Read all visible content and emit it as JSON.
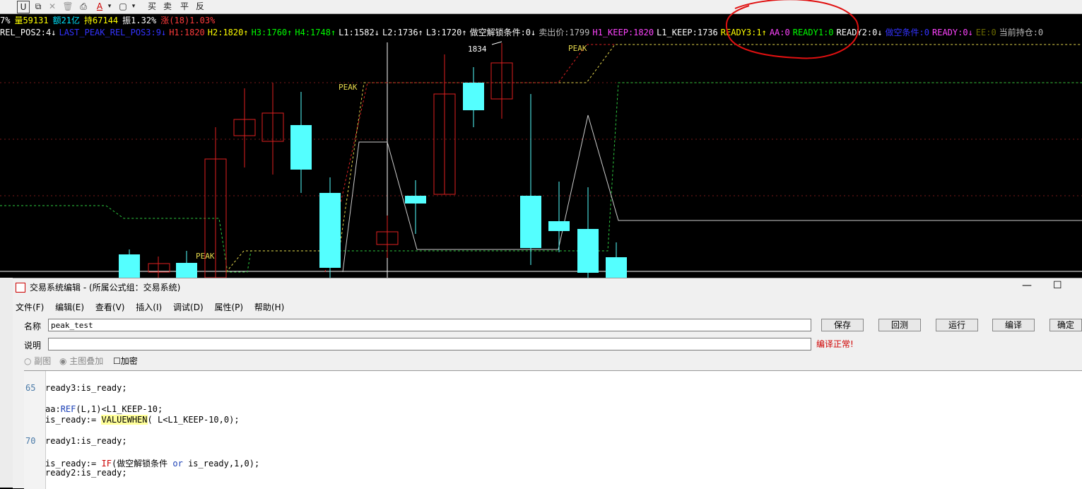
{
  "toolbar": {
    "buttons": [
      "U",
      "⧉",
      "✕",
      "🗑",
      "⎙",
      "A",
      "▾",
      "▢",
      "▾",
      "买",
      "卖",
      "平",
      "反"
    ]
  },
  "status_bar": [
    {
      "text": "7%",
      "color": "#ffffff"
    },
    {
      "text": "量59131",
      "color": "#ffff00"
    },
    {
      "text": "额21亿",
      "color": "#00e5ff"
    },
    {
      "text": "持67144",
      "color": "#ffff00"
    },
    {
      "text": "振1.32%",
      "color": "#ffffff"
    },
    {
      "text": "涨(18)1.03%",
      "color": "#ff3b3b"
    }
  ],
  "indicator_bar": [
    {
      "text": "REL_POS2:4↓",
      "color": "#ffffff"
    },
    {
      "text": "LAST_PEAK_REL_POS3:9↓",
      "color": "#3333ff"
    },
    {
      "text": "H1:1820",
      "color": "#ff3b3b"
    },
    {
      "text": "H2:1820↑",
      "color": "#ffff00"
    },
    {
      "text": "H3:1760↑",
      "color": "#00ff00"
    },
    {
      "text": "H4:1748↑",
      "color": "#00ff00"
    },
    {
      "text": "L1:1582↓",
      "color": "#ffffff"
    },
    {
      "text": "L2:1736↑",
      "color": "#ffffff"
    },
    {
      "text": "L3:1720↑",
      "color": "#ffffff"
    },
    {
      "text": "做空解锁条件:0↓",
      "color": "#ffffff"
    },
    {
      "text": "卖出价:1799",
      "color": "#bbbbbb"
    },
    {
      "text": "H1_KEEP:1820",
      "color": "#ff44ff"
    },
    {
      "text": "L1_KEEP:1736",
      "color": "#ffffff"
    },
    {
      "text": "READY3:1↑",
      "color": "#ffff00"
    },
    {
      "text": "AA:0",
      "color": "#ff44ff"
    },
    {
      "text": "READY1:0",
      "color": "#00ff00"
    },
    {
      "text": "READY2:0↓",
      "color": "#ffffff"
    },
    {
      "text": "做空条件:0",
      "color": "#3333ff"
    },
    {
      "text": "READY:0↓",
      "color": "#ff44ff"
    },
    {
      "text": "EE:0",
      "color": "#6b6b00"
    },
    {
      "text": "当前持仓:0",
      "color": "#bbbbbb"
    }
  ],
  "chart_labels": {
    "peak1": "PEAK",
    "peak2": "PEAK",
    "peak3": "PEAK",
    "price": "1834"
  },
  "editor": {
    "title": "交易系统编辑 - (所属公式组：交易系统)",
    "menu": [
      "文件(F)",
      "编辑(E)",
      "查看(V)",
      "插入(I)",
      "调试(D)",
      "属性(P)",
      "帮助(H)"
    ],
    "name_label": "名称",
    "name_value": "peak_test",
    "desc_label": "说明",
    "desc_value": "",
    "buttons": {
      "save": "保存",
      "backtest": "回测",
      "run": "运行",
      "compile": "编译",
      "ok": "确定"
    },
    "compile_status": "编译正常!",
    "options": {
      "sub": "副图",
      "main": "主图叠加",
      "encrypt": "加密"
    },
    "line_numbers": {
      "l65": "65",
      "l70": "70"
    },
    "code": {
      "line1": "ready3:is_ready;",
      "line2_a": "aa:",
      "line2_kw": "REF",
      "line2_b": "(L,1)<L1_KEEP-10;",
      "line3_a": "is_ready:= ",
      "line3_kw": "VALUEWHEN",
      "line3_b": "( L<L1_KEEP-10,0);",
      "line4": "ready1:is_ready;",
      "line5_a": "is_ready:= ",
      "line5_kw": "IF",
      "line5_b": "(做空解锁条件 ",
      "line5_or": "or",
      "line5_c": " is_ready,1,0);",
      "line6": "ready2:is_ready;"
    }
  }
}
